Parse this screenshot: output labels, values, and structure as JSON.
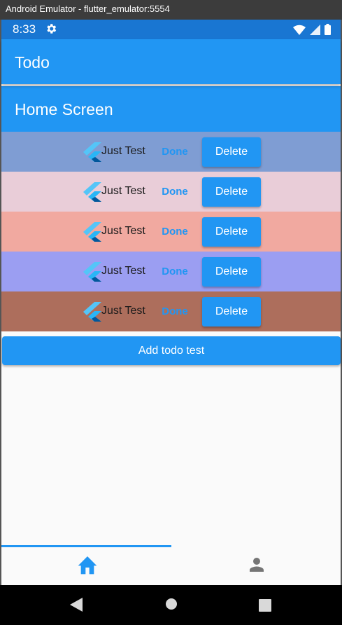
{
  "window": {
    "title": "Android Emulator - flutter_emulator:5554"
  },
  "status_bar": {
    "time": "8:33",
    "settings_icon": "gear-icon",
    "wifi_icon": "wifi-icon",
    "signal_icon": "signal-icon",
    "battery_icon": "battery-icon"
  },
  "app_bar": {
    "title": "Todo"
  },
  "home": {
    "title": "Home Screen"
  },
  "todos": [
    {
      "text": "Just Test",
      "done_label": "Done",
      "delete_label": "Delete",
      "color": "#7f9dd3"
    },
    {
      "text": "Just Test",
      "done_label": "Done",
      "delete_label": "Delete",
      "color": "#e9cdd8"
    },
    {
      "text": "Just Test",
      "done_label": "Done",
      "delete_label": "Delete",
      "color": "#f1a9a0"
    },
    {
      "text": "Just Test",
      "done_label": "Done",
      "delete_label": "Delete",
      "color": "#9b9ef2"
    },
    {
      "text": "Just Test",
      "done_label": "Done",
      "delete_label": "Delete",
      "color": "#ad6e5c"
    }
  ],
  "add_button": {
    "label": "Add todo test"
  },
  "bottom_nav": {
    "items": [
      {
        "icon": "home-icon",
        "active": true
      },
      {
        "icon": "person-icon",
        "active": false
      }
    ]
  },
  "colors": {
    "primary": "#2196f3",
    "status_bar": "#1976d2"
  }
}
